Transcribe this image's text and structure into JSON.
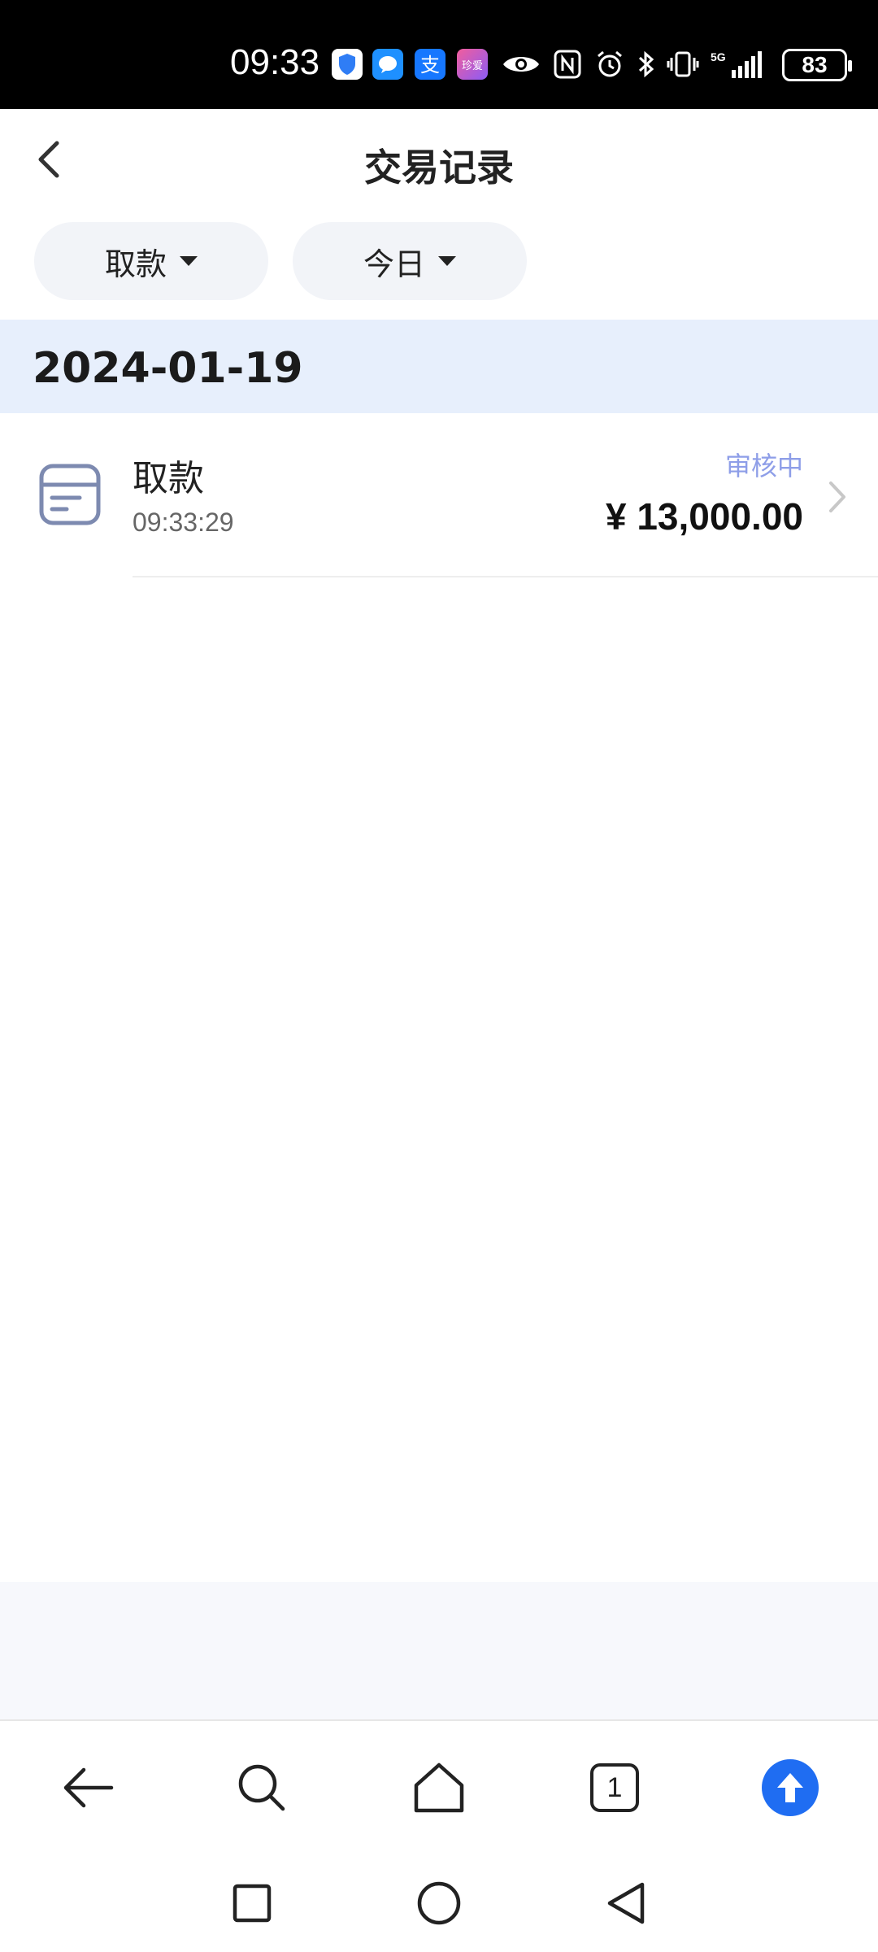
{
  "status_bar": {
    "time": "09:33",
    "battery": "83",
    "network": "5G",
    "icons": [
      "shield-app-icon",
      "message-app-icon",
      "alipay-app-icon",
      "zhenai-app-icon",
      "eye-icon",
      "nfc-icon",
      "alarm-icon",
      "bluetooth-icon",
      "vibrate-icon",
      "signal-icon"
    ]
  },
  "header": {
    "title": "交易记录",
    "back_icon": "chevron-left-icon"
  },
  "filters": {
    "type_label": "取款",
    "period_label": "今日"
  },
  "section": {
    "date": "2024-01-19"
  },
  "transactions": [
    {
      "type": "取款",
      "time": "09:33:29",
      "status": "审核中",
      "amount": "¥ 13,000.00"
    }
  ],
  "browser_toolbar": {
    "tab_count": "1"
  },
  "colors": {
    "accent_blue": "#1f6df2",
    "status_pending": "#8e9ee8",
    "date_band": "#e7effc",
    "pill_bg": "#f2f4f8"
  }
}
